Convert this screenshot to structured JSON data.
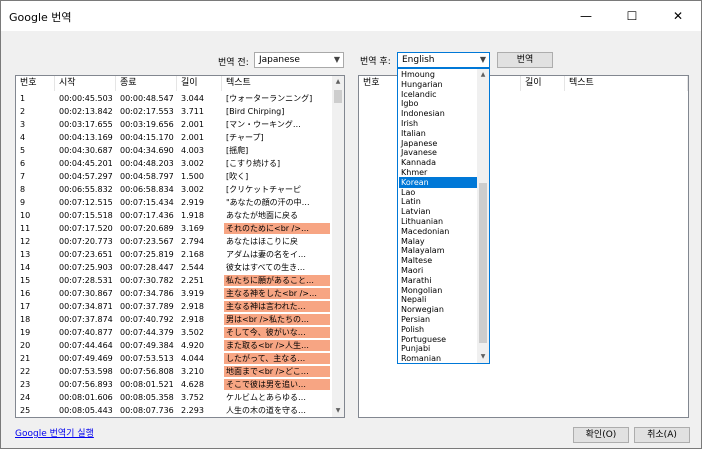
{
  "window": {
    "title": "Google 번역",
    "minimize": "—",
    "maximize": "☐",
    "close": "✕"
  },
  "source": {
    "label": "번역 전:",
    "value": "Japanese"
  },
  "target": {
    "label": "번역 후:",
    "value": "English"
  },
  "translate_button": "번역",
  "left_table": {
    "headers": [
      "번호",
      "시작",
      "종료",
      "길이",
      "텍스트"
    ],
    "rows": [
      {
        "no": "1",
        "start": "00:00:45.503",
        "end": "00:00:48.547",
        "len": "3.044",
        "text": "[ウォーターランニング]",
        "hl": false
      },
      {
        "no": "2",
        "start": "00:02:13.842",
        "end": "00:02:17.553",
        "len": "3.711",
        "text": "[Bird Chirping]",
        "hl": false
      },
      {
        "no": "3",
        "start": "00:03:17.655",
        "end": "00:03:19.656",
        "len": "2.001",
        "text": "[マン・ウーキング…",
        "hl": false
      },
      {
        "no": "4",
        "start": "00:04:13.169",
        "end": "00:04:15.170",
        "len": "2.001",
        "text": "[チャープ]",
        "hl": false
      },
      {
        "no": "5",
        "start": "00:04:30.687",
        "end": "00:04:34.690",
        "len": "4.003",
        "text": "[揺爬]",
        "hl": false
      },
      {
        "no": "6",
        "start": "00:04:45.201",
        "end": "00:04:48.203",
        "len": "3.002",
        "text": "[こすり続ける]",
        "hl": false
      },
      {
        "no": "7",
        "start": "00:04:57.297",
        "end": "00:04:58.797",
        "len": "1.500",
        "text": "[吹く]",
        "hl": false
      },
      {
        "no": "8",
        "start": "00:06:55.832",
        "end": "00:06:58.834",
        "len": "3.002",
        "text": "[クリケットチャーピ",
        "hl": false
      },
      {
        "no": "9",
        "start": "00:07:12.515",
        "end": "00:07:15.434",
        "len": "2.919",
        "text": "\"あなたの顔の汗の中…",
        "hl": false
      },
      {
        "no": "10",
        "start": "00:07:15.518",
        "end": "00:07:17.436",
        "len": "1.918",
        "text": "あなたが地面に戻る",
        "hl": false
      },
      {
        "no": "11",
        "start": "00:07:17.520",
        "end": "00:07:20.689",
        "len": "3.169",
        "text": "それのために<br />…",
        "hl": true
      },
      {
        "no": "12",
        "start": "00:07:20.773",
        "end": "00:07:23.567",
        "len": "2.794",
        "text": "あなたはほこりに戻",
        "hl": false
      },
      {
        "no": "13",
        "start": "00:07:23.651",
        "end": "00:07:25.819",
        "len": "2.168",
        "text": "アダムは妻の名をイ…",
        "hl": false
      },
      {
        "no": "14",
        "start": "00:07:25.903",
        "end": "00:07:28.447",
        "len": "2.544",
        "text": "彼女はすべての生き…",
        "hl": false
      },
      {
        "no": "15",
        "start": "00:07:28.531",
        "end": "00:07:30.782",
        "len": "2.251",
        "text": "私たちに願があること…",
        "hl": true
      },
      {
        "no": "16",
        "start": "00:07:30.867",
        "end": "00:07:34.786",
        "len": "3.919",
        "text": "主なる神をした<br />…",
        "hl": true
      },
      {
        "no": "17",
        "start": "00:07:34.871",
        "end": "00:07:37.789",
        "len": "2.918",
        "text": "主なる神は言われた…",
        "hl": true
      },
      {
        "no": "18",
        "start": "00:07:37.874",
        "end": "00:07:40.792",
        "len": "2.918",
        "text": "男は<br />私たちの…",
        "hl": true
      },
      {
        "no": "19",
        "start": "00:07:40.877",
        "end": "00:07:44.379",
        "len": "3.502",
        "text": "そして今、彼がいな…",
        "hl": true
      },
      {
        "no": "20",
        "start": "00:07:44.464",
        "end": "00:07:49.384",
        "len": "4.920",
        "text": "また取る<br />人生…",
        "hl": true
      },
      {
        "no": "21",
        "start": "00:07:49.469",
        "end": "00:07:53.513",
        "len": "4.044",
        "text": "したがって、主なる…",
        "hl": true
      },
      {
        "no": "22",
        "start": "00:07:53.598",
        "end": "00:07:56.808",
        "len": "3.210",
        "text": "地面まで<br />どこ…",
        "hl": true
      },
      {
        "no": "23",
        "start": "00:07:56.893",
        "end": "00:08:01.521",
        "len": "4.628",
        "text": "そこで彼は男を追い…",
        "hl": true
      },
      {
        "no": "24",
        "start": "00:08:01.606",
        "end": "00:08:05.358",
        "len": "3.752",
        "text": "ケルビムとあらゆる…",
        "hl": false
      },
      {
        "no": "25",
        "start": "00:08:05.443",
        "end": "00:08:07.736",
        "len": "2.293",
        "text": "人生の木の道を守る…",
        "hl": false
      }
    ]
  },
  "right_table": {
    "headers": [
      "번호",
      "길이",
      "텍스트"
    ]
  },
  "languages": [
    "Hmoung",
    "Hungarian",
    "Icelandic",
    "Igbo",
    "Indonesian",
    "Irish",
    "Italian",
    "Japanese",
    "Javanese",
    "Kannada",
    "Khmer",
    "Korean",
    "Lao",
    "Latin",
    "Latvian",
    "Lithuanian",
    "Macedonian",
    "Malay",
    "Malayalam",
    "Maltese",
    "Maori",
    "Marathi",
    "Mongolian",
    "Nepali",
    "Norwegian",
    "Persian",
    "Polish",
    "Portuguese",
    "Punjabi",
    "Romanian"
  ],
  "selected_language": "Korean",
  "footer": {
    "link": "Google 번역기 실행",
    "ok": "확인(O)",
    "cancel": "취소(A)"
  }
}
